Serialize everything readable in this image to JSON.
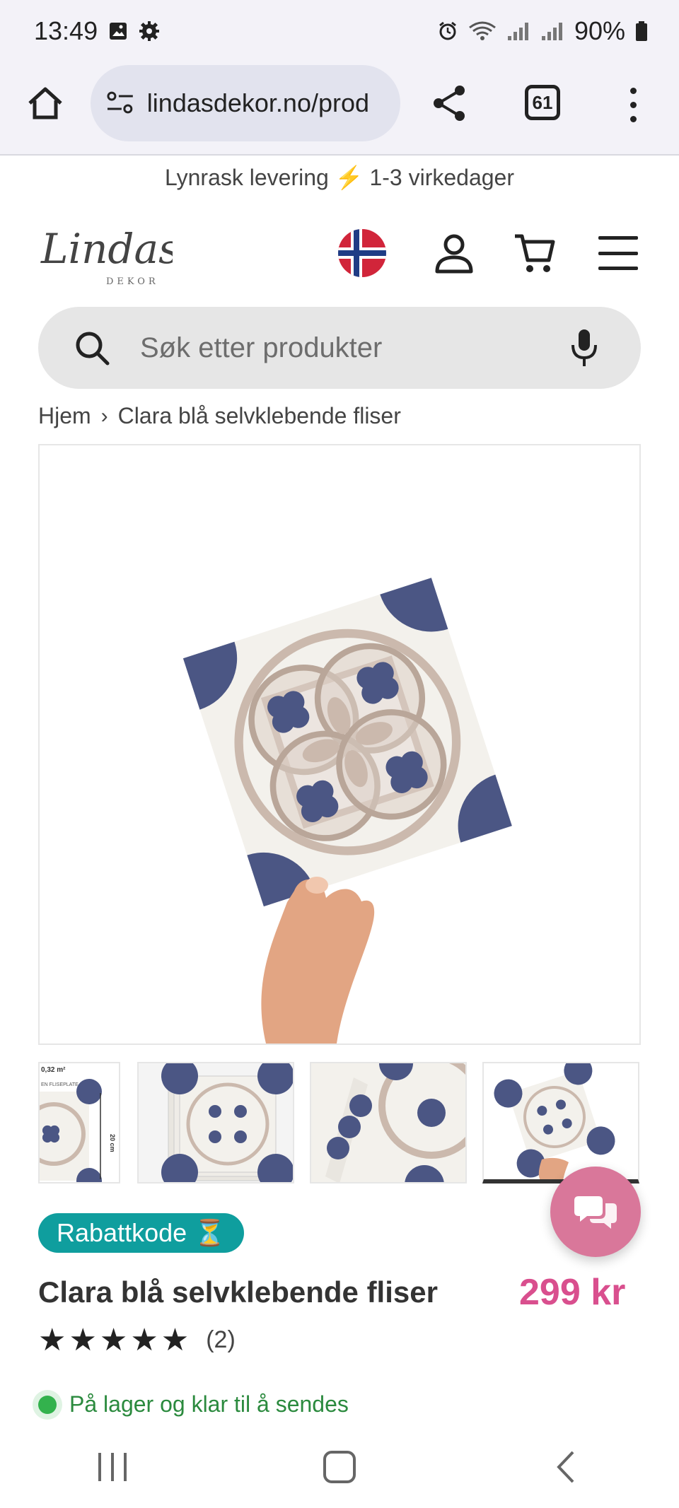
{
  "status_bar": {
    "time": "13:49",
    "battery": "90%"
  },
  "browser": {
    "url": "lindasdekor.no/prod",
    "tab_count": "61"
  },
  "promo": {
    "text_before": "Lynrask levering",
    "bolt": "⚡",
    "text_after": "1-3 virkedager"
  },
  "header": {
    "logo_text": "Lindas",
    "logo_sub": "DEKOR"
  },
  "search": {
    "placeholder": "Søk etter produkter"
  },
  "breadcrumb": {
    "home": "Hjem",
    "separator": "›",
    "current": "Clara blå selvklebende fliser"
  },
  "thumbnails": {
    "thumb1_label_top": "0,32 m²",
    "thumb1_label_sub": "EN FLISEPLATE",
    "thumb1_label_side": "20 cm"
  },
  "product": {
    "badge": "Rabattkode",
    "badge_icon": "⏳",
    "title": "Clara blå selvklebende fliser",
    "price": "299 kr",
    "stars": "★★★★★",
    "rating_value": 5,
    "review_count": "(2)",
    "stock": "På lager og klar til å sendes"
  },
  "colors": {
    "accent_pink": "#d94f8e",
    "badge_teal": "#0f9e9e",
    "tile_blue": "#4b5684",
    "tile_beige": "#cbb9ad"
  }
}
